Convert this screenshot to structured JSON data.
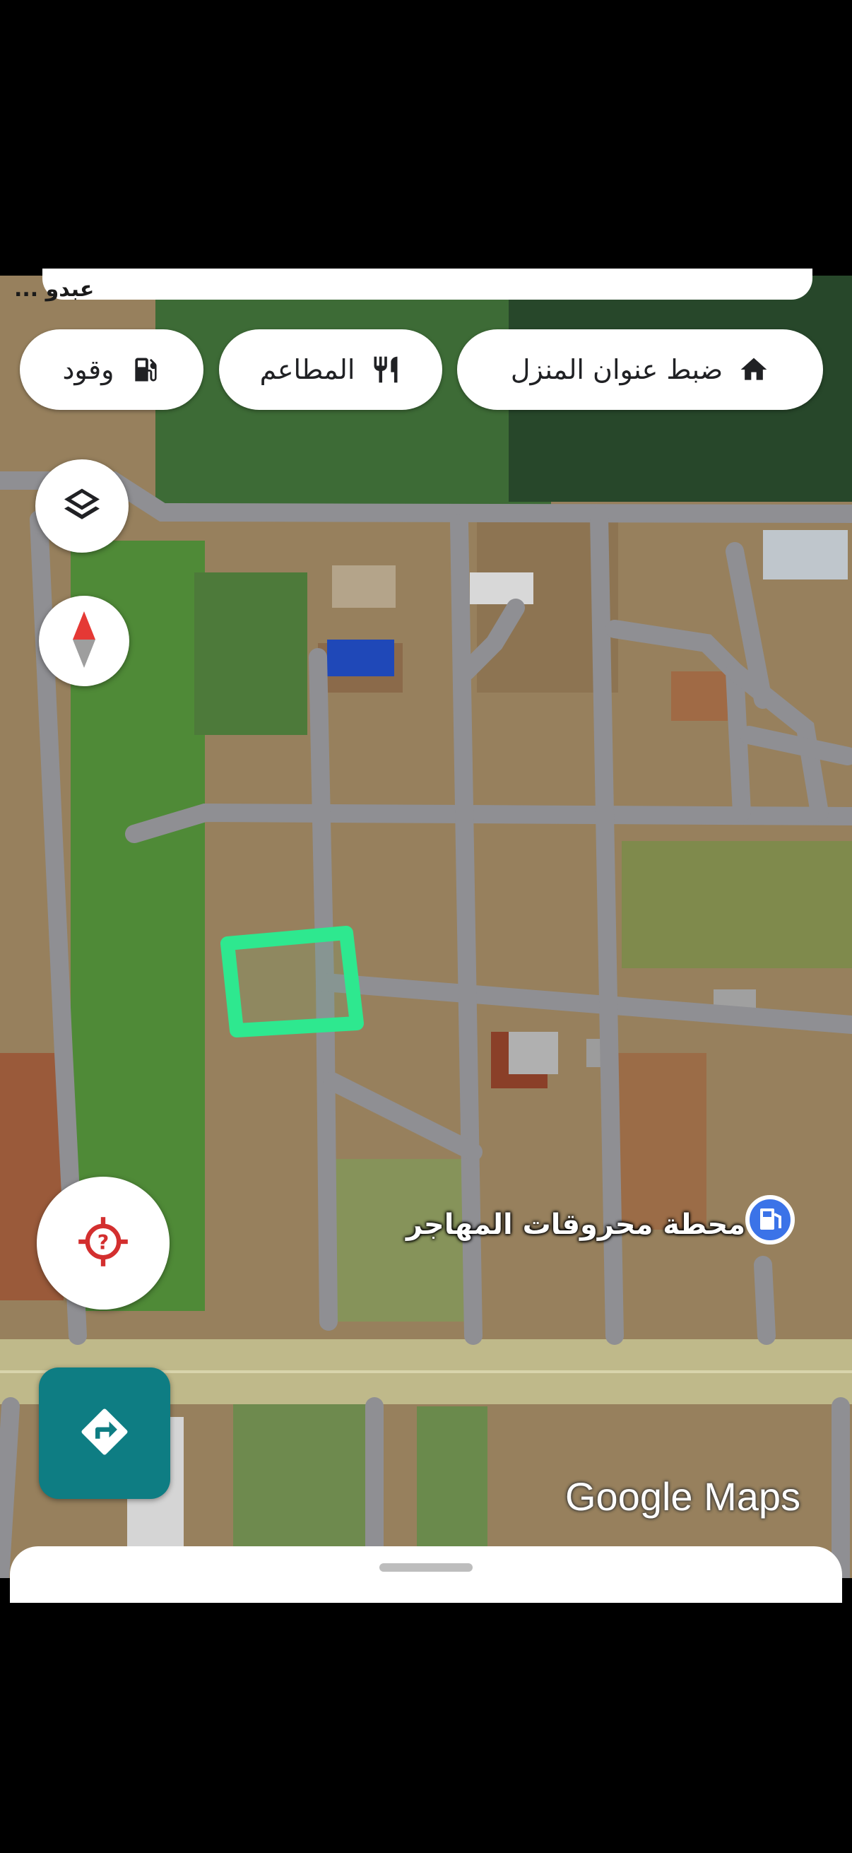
{
  "top_fragment": "عبدو ...",
  "chips": {
    "home": {
      "label": "ضبط عنوان المنزل",
      "icon": "home-icon"
    },
    "restaurants": {
      "label": "المطاعم",
      "icon": "fork-knife-icon"
    },
    "fuel": {
      "label": "وقود",
      "icon": "fuel-pump-icon"
    }
  },
  "controls": {
    "layers": {
      "icon": "layers-icon"
    },
    "compass": {
      "icon": "compass-icon"
    },
    "location": {
      "icon": "location-unknown-icon"
    },
    "directions": {
      "icon": "directions-icon"
    }
  },
  "poi": {
    "label": "محطة محروقات المهاجر",
    "icon": "gas-station-pin-icon"
  },
  "watermark": "Google Maps",
  "colors": {
    "highlight": "#2ee88f",
    "road": "#8f8f93",
    "accent": "#0e7d83"
  }
}
